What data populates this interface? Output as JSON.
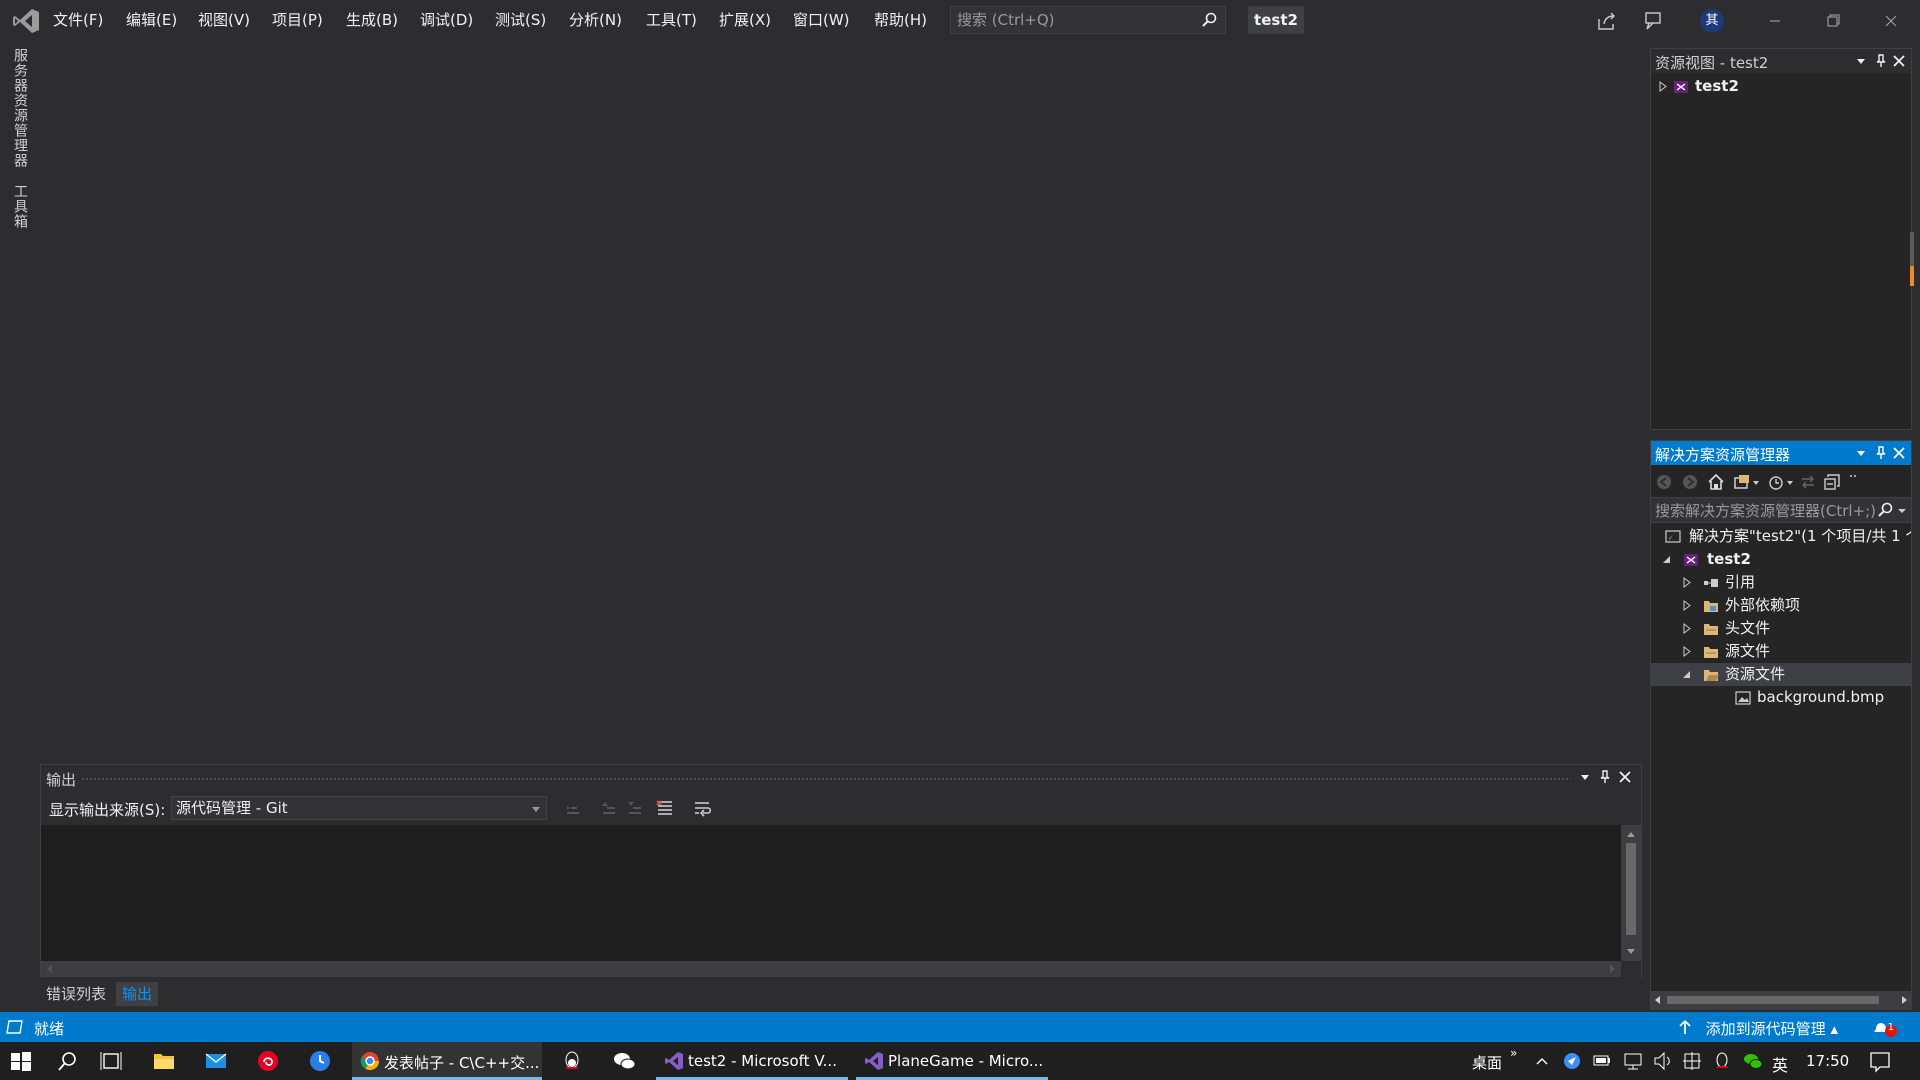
{
  "menu": {
    "file": "文件(F)",
    "edit": "编辑(E)",
    "view": "视图(V)",
    "project": "项目(P)",
    "build": "生成(B)",
    "debug": "调试(D)",
    "test": "测试(S)",
    "analyze": "分析(N)",
    "tools": "工具(T)",
    "extensions": "扩展(X)",
    "window": "窗口(W)",
    "help": "帮助(H)"
  },
  "search": {
    "placeholder": "搜索 (Ctrl+Q)"
  },
  "solution_badge": "test2",
  "user_initial": "其",
  "left_tabs": {
    "server_explorer": "服务器资源管理器",
    "toolbox": "工具箱"
  },
  "resource_view": {
    "title": "资源视图 - test2",
    "root": "test2"
  },
  "solution_explorer": {
    "title": "解决方案资源管理器",
    "search_placeholder": "搜索解决方案资源管理器(Ctrl+;)",
    "solution_line": "解决方案\"test2\"(1 个项目/共 1 个",
    "project": "test2",
    "nodes": {
      "references": "引用",
      "external_deps": "外部依赖项",
      "header_files": "头文件",
      "source_files": "源文件",
      "resource_files": "资源文件",
      "background": "background.bmp"
    }
  },
  "output": {
    "title": "输出",
    "source_label": "显示输出来源(S):",
    "source_value": "源代码管理 - Git"
  },
  "bottom_tabs": {
    "error_list": "错误列表",
    "output": "输出"
  },
  "status": {
    "ready": "就绪",
    "scm": "添加到源代码管理",
    "notifications": "1"
  },
  "taskbar": {
    "chrome": "发表帖子 - C\\C++交...",
    "vs1": "test2 - Microsoft V...",
    "vs2": "PlaneGame - Micro...",
    "desktop": "桌面",
    "ime": "英",
    "time": "17:50"
  },
  "colors": {
    "accent": "#007acc",
    "background": "#2d2d30",
    "vs_purple": "#865fc5"
  }
}
